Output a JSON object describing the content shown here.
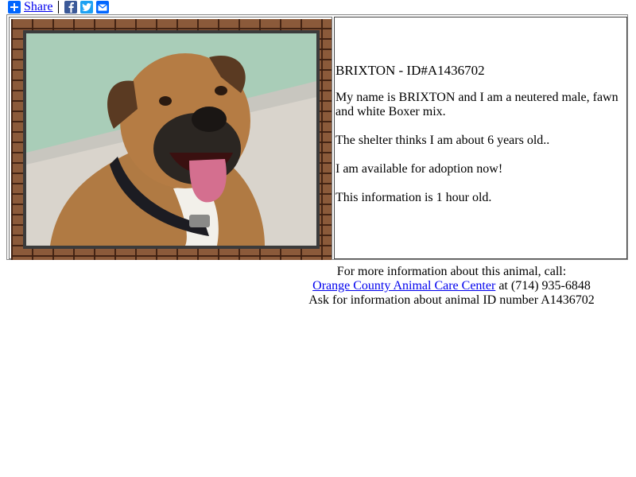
{
  "share_bar": {
    "share_label": "Share",
    "icons": [
      "plus-icon",
      "facebook-icon",
      "twitter-icon",
      "email-icon"
    ]
  },
  "animal": {
    "title": "BRIXTON - ID#A1436702",
    "description": "My name is BRIXTON and I am a neutered male, fawn and white Boxer mix.",
    "age_text": "The shelter thinks I am about 6 years old..",
    "availability": "I am available for adoption now!",
    "freshness": "This information is 1 hour old."
  },
  "footer": {
    "line1": "For more information about this animal, call:",
    "shelter_link": "Orange County Animal Care Center",
    "phone_text": " at (714) 935-6848",
    "line3": "Ask for information about animal ID number A1436702"
  },
  "colors": {
    "link": "#0000ee",
    "share_blue": "#0166ff",
    "facebook": "#3b5998",
    "twitter": "#1da1f2",
    "brick": "#8b5a3a"
  }
}
